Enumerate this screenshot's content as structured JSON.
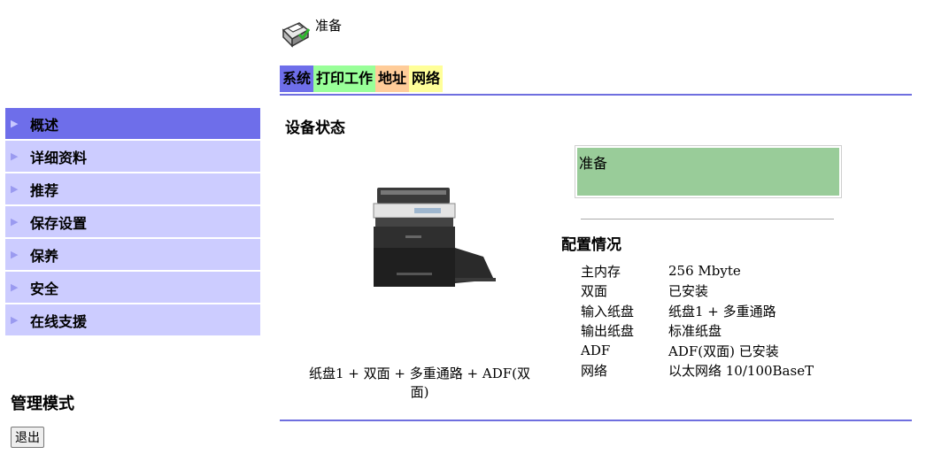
{
  "header": {
    "status_text": "准备",
    "icon": "printer-status-icon"
  },
  "tabs": [
    {
      "label": "系统",
      "color": "#6e6eea"
    },
    {
      "label": "打印工作",
      "color": "#99ff99"
    },
    {
      "label": "地址",
      "color": "#ffcc99"
    },
    {
      "label": "网络",
      "color": "#ffff99"
    }
  ],
  "sidebar": {
    "items": [
      {
        "label": "概述"
      },
      {
        "label": "详细资料"
      },
      {
        "label": "推荐"
      },
      {
        "label": "保存设置"
      },
      {
        "label": "保养"
      },
      {
        "label": "安全"
      },
      {
        "label": "在线支援"
      }
    ],
    "active_index": 0,
    "admin_title": "管理模式",
    "logout_label": "退出"
  },
  "main": {
    "section_title": "设备状态",
    "status_box_text": "准备",
    "status_color": "#99cc99",
    "config_title": "配置情况",
    "config": [
      {
        "key": "主内存",
        "value": "256 Mbyte"
      },
      {
        "key": "双面",
        "value": "已安装"
      },
      {
        "key": "输入纸盘",
        "value": "纸盘1 + 多重通路"
      },
      {
        "key": "输出纸盘",
        "value": "标准纸盘"
      },
      {
        "key": "ADF",
        "value": "ADF(双面) 已安装"
      },
      {
        "key": "网络",
        "value": "以太网络 10/100BaseT"
      }
    ],
    "paper_path_line1": "纸盘1 + 双面 + 多重通路 + ADF(双",
    "paper_path_line2": "面)"
  },
  "colors": {
    "accent": "#6f6fdf",
    "sidebar_bg": "#ccccff",
    "sidebar_active": "#6e6eea"
  }
}
